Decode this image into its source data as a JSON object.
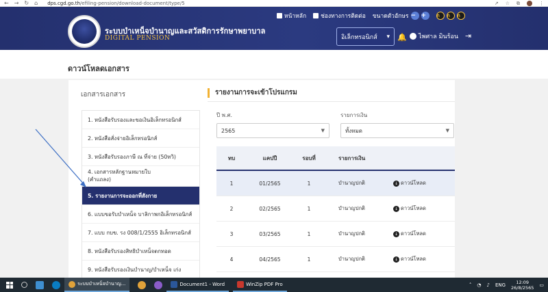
{
  "browser": {
    "nav": [
      "←",
      "→",
      "↻",
      "⌂"
    ],
    "url_domain": "dps.cgd.go.th",
    "url_path": "/efiling-pension/download-document/type/5",
    "right_icons": [
      "↗",
      "☆",
      "⧉",
      "⋮"
    ]
  },
  "header": {
    "title": "ระบบบำเหน็จบำนาญและสวัสดิการรักษาพยาบาล",
    "subtitle": "DIGITAL PENSION",
    "links": {
      "home": "หน้าหลัก",
      "contact": "ช่องทางการติดต่อ",
      "font_size": "ขนาดตัวอักษร"
    },
    "font_minus": "−",
    "font_plus": "+",
    "contrast_labels": [
      "ก",
      "ก",
      "ก"
    ],
    "select_value": "อิเล็กทรอนิกส์",
    "user_name": "ไพศาล มินร้อน"
  },
  "page": {
    "title": "ดาวน์โหลดเอกสาร"
  },
  "left": {
    "heading": "เอกสารเอกสาร",
    "items": [
      "1. หนังสือรับรองและขอเงินอิเล็กทรอนิกส์",
      "2. หนังสือสั่งจ่ายอิเล็กทรอนิกส์",
      "3. หนังสือรับรองภาษี ณ ที่จ่าย (50ทวิ)",
      "4. เอกสารหลักฐานหมายใบ",
      "(คำแถลง)",
      "5. รายงานการจะออกที่สังกาย",
      "6. แบบขอรับบำเหน็จ บาลิกาพกอิเล็กทรอนิกส์",
      "7. แบบ กบข. รง 008/1/2555 อิเล็กทรอนิกส์",
      "8. หนังสือรับรองสิทธิบำเหน็จตกทอด",
      "9. หนังสือรับรองเงินบำนาญ/บำเหน็จ เก่ง"
    ]
  },
  "right": {
    "heading": "รายงานการจะเข้าโปรแกรม",
    "year_label": "ปี พ.ศ.",
    "year_value": "2565",
    "type_label": "รายการเงิน",
    "type_value": "ทั้งหมด",
    "columns": [
      "ทบ",
      "แคปปี",
      "รอบที่",
      "รายการเงิน",
      ""
    ],
    "rows": [
      {
        "no": "1",
        "period": "01/2565",
        "round": "1",
        "type": "บำนาญปกติ",
        "action": "ดาวน์โหลด"
      },
      {
        "no": "2",
        "period": "02/2565",
        "round": "1",
        "type": "บำนาญปกติ",
        "action": "ดาวน์โหลด"
      },
      {
        "no": "3",
        "period": "03/2565",
        "round": "1",
        "type": "บำนาญปกติ",
        "action": "ดาวน์โหลด"
      },
      {
        "no": "4",
        "period": "04/2565",
        "round": "1",
        "type": "บำนาญปกติ",
        "action": "ดาวน์โหลด"
      }
    ]
  },
  "taskbar": {
    "apps": [
      "ระบบบำเหน็จบำนาญ...",
      "Document1 - Word",
      "WinZip PDF Pro"
    ],
    "lang": "ENG",
    "time": "12:09",
    "date": "26/8/2565"
  },
  "colors": {
    "header_bg": "#24306e",
    "accent": "#f2b233",
    "brand_gold": "#f5c242"
  }
}
